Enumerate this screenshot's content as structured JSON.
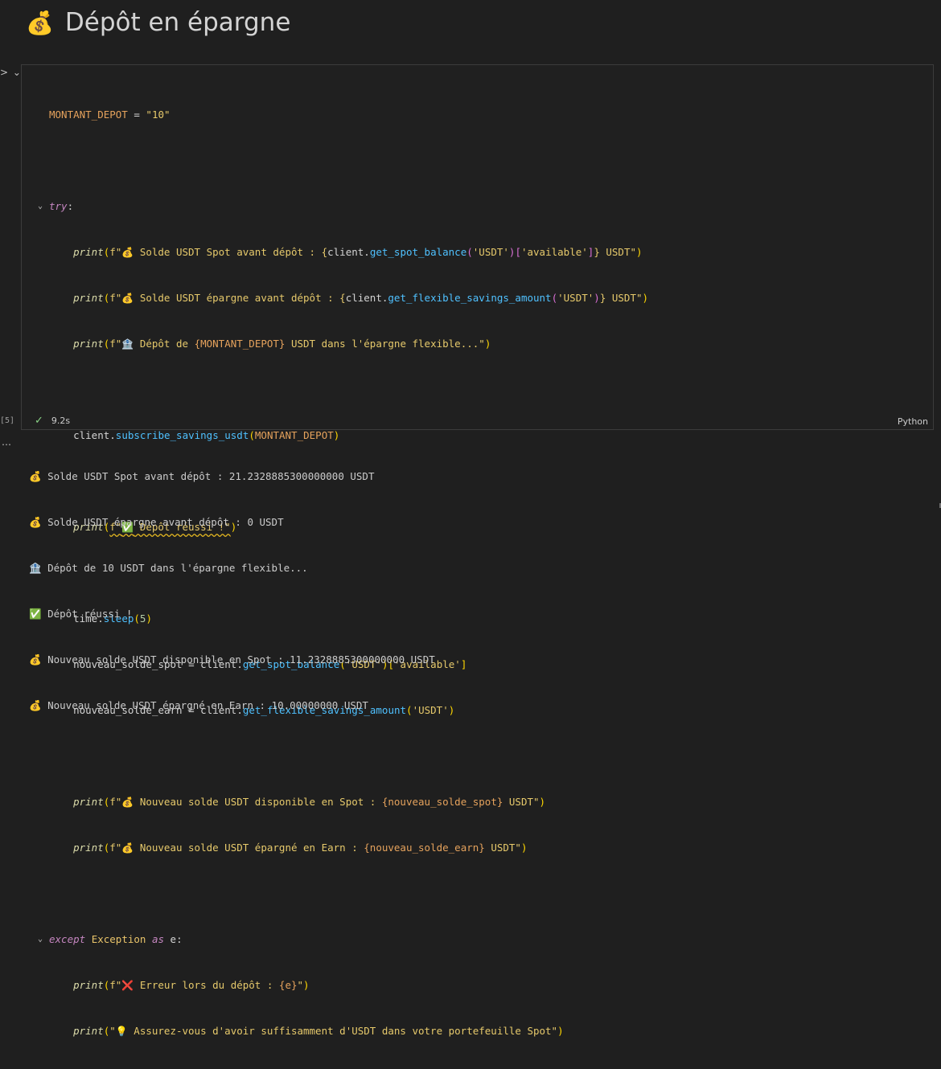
{
  "header": {
    "emoji": "💰",
    "title": "Dépôt en épargne"
  },
  "cell": {
    "execution_count": "[5]",
    "exec_time": "9.2s",
    "language": "Python",
    "code": {
      "l1": {
        "var": "MONTANT_DEPOT",
        "op": " = ",
        "val": "\"10\""
      },
      "try_kw": "try",
      "p1": {
        "emo": "💰",
        "text": " Solde USDT Spot avant dépôt : {",
        "obj": "client",
        "m": "get_spot_balance",
        "a1": "'USDT'",
        "a2": "'available'",
        "tail": " USDT\""
      },
      "p2": {
        "emo": "💰",
        "text": " Solde USDT épargne avant dépôt : {",
        "obj": "client",
        "m": "get_flexible_savings_amount",
        "a1": "'USDT'",
        "tail": " USDT\""
      },
      "p3": {
        "emo": "🏦",
        "text": " Dépôt de ",
        "var": "{MONTANT_DEPOT}",
        "tail": " USDT dans l'épargne flexible...\""
      },
      "sub": {
        "obj": "client",
        "m": "subscribe_savings_usdt",
        "arg": "MONTANT_DEPOT"
      },
      "p4": {
        "emo": "✅",
        "text": " Dépôt réussi !\""
      },
      "sleep": {
        "obj": "time",
        "m": "sleep",
        "arg": "5"
      },
      "ns": {
        "var": "nouveau_solde_spot",
        "obj": "client",
        "m": "get_spot_balance",
        "a1": "'USDT'",
        "a2": "'available'"
      },
      "ne": {
        "var": "nouveau_solde_earn",
        "obj": "client",
        "m": "get_flexible_savings_amount",
        "a1": "'USDT'"
      },
      "p5": {
        "emo": "💰",
        "text": " Nouveau solde USDT disponible en Spot : ",
        "var": "{nouveau_solde_spot}",
        "tail": " USDT\""
      },
      "p6": {
        "emo": "💰",
        "text": " Nouveau solde USDT épargné en Earn : ",
        "var": "{nouveau_solde_earn}",
        "tail": " USDT\""
      },
      "exc": {
        "kw": "except",
        "cls": "Exception",
        "as": "as",
        "var": "e"
      },
      "p7": {
        "emo": "❌",
        "text": " Erreur lors du dépôt : ",
        "var": "{e}",
        "tail": "\""
      },
      "p8": {
        "emo": "💡",
        "text": " Assurez-vous d'avoir suffisamment d'USDT dans votre portefeuille Spot\""
      }
    }
  },
  "output": [
    {
      "emo": "💰",
      "text": " Solde USDT Spot avant dépôt : 21.2328885300000000 USDT"
    },
    {
      "emo": "💰",
      "text": " Solde USDT épargne avant dépôt : 0 USDT"
    },
    {
      "emo": "🏦",
      "text": " Dépôt de 10 USDT dans l'épargne flexible..."
    },
    {
      "emo": "✅",
      "text": " Dépôt réussi !"
    },
    {
      "emo": "💰",
      "text": " Nouveau solde USDT disponible en Spot : 11.2328885300000000 USDT"
    },
    {
      "emo": "💰",
      "text": " Nouveau solde USDT épargné en Earn : 10.00000000 USDT"
    }
  ]
}
